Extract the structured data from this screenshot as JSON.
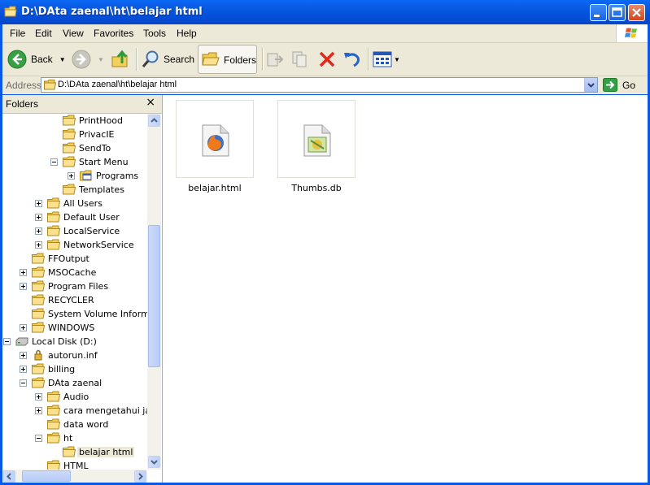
{
  "window": {
    "title": "D:\\DAta  zaenal\\ht\\belajar html"
  },
  "menu": [
    "File",
    "Edit",
    "View",
    "Favorites",
    "Tools",
    "Help"
  ],
  "toolbar": {
    "back_label": "Back",
    "search_label": "Search",
    "folders_label": "Folders"
  },
  "address": {
    "label": "Address",
    "value": "D:\\DAta  zaenal\\ht\\belajar html",
    "go_label": "Go"
  },
  "folders_pane": {
    "title": "Folders",
    "close": "×",
    "tree": [
      {
        "label": "PrintHood"
      },
      {
        "label": "PrivacIE"
      },
      {
        "label": "SendTo"
      },
      {
        "label": "Start Menu",
        "expander": "minus"
      },
      {
        "label": "Programs",
        "expander": "plus",
        "icon": "programs-folder-icon"
      },
      {
        "label": "Templates"
      },
      {
        "label": "All Users",
        "expander": "plus"
      },
      {
        "label": "Default User",
        "expander": "plus"
      },
      {
        "label": "LocalService",
        "expander": "plus"
      },
      {
        "label": "NetworkService",
        "expander": "plus"
      },
      {
        "label": "FFOutput"
      },
      {
        "label": "MSOCache",
        "expander": "plus"
      },
      {
        "label": "Program Files",
        "expander": "plus"
      },
      {
        "label": "RECYCLER"
      },
      {
        "label": "System Volume Informati"
      },
      {
        "label": "WINDOWS",
        "expander": "plus"
      },
      {
        "label": "Local Disk (D:)",
        "expander": "minus",
        "icon": "drive-icon"
      },
      {
        "label": "autorun.inf",
        "expander": "plus",
        "icon": "lock-folder-icon"
      },
      {
        "label": "billing",
        "expander": "plus"
      },
      {
        "label": "DAta  zaenal",
        "expander": "minus"
      },
      {
        "label": "Audio",
        "expander": "plus"
      },
      {
        "label": "cara mengetahui jalu",
        "expander": "plus"
      },
      {
        "label": "data word"
      },
      {
        "label": "ht",
        "expander": "minus"
      },
      {
        "label": "belajar html",
        "selected": true
      },
      {
        "label": "HTML"
      }
    ]
  },
  "files": [
    {
      "name": "belajar.html",
      "icon": "firefox-html-file-icon"
    },
    {
      "name": "Thumbs.db",
      "icon": "thumbs-db-file-icon"
    }
  ],
  "colors": {
    "titlebar": "#0a59e6",
    "chrome": "#ece9d8",
    "close_button": "#d2451e",
    "go_arrow": "#2e9a3a"
  }
}
